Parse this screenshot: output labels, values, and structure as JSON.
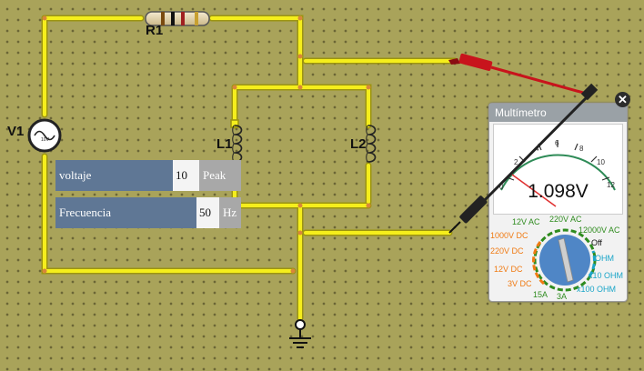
{
  "components": {
    "resistor": "R1",
    "source": "V1",
    "inductor_1": "L1",
    "inductor_2": "L2"
  },
  "source_panel": {
    "voltage_label": "voltaje",
    "voltage_value": "10",
    "voltage_unit": "Peak",
    "frequency_label": "Frecuencia",
    "frequency_value": "50",
    "frequency_unit": "Hz"
  },
  "multimeter": {
    "title": "Multímetro",
    "reading": "1.098V",
    "scale_ticks": [
      "0",
      "2",
      "4",
      "6",
      "8",
      "10",
      "12"
    ],
    "dial_options": {
      "ac_12v": "12V AC",
      "ac_220v": "220V AC",
      "ac_12000v": "12000V AC",
      "off": "Off",
      "dc_1000v": "1000V DC",
      "dc_220v": "220V DC",
      "dc_12v": "12V DC",
      "dc_3v": "3V DC",
      "ohm": "OHM",
      "ohm_x10": "x10 OHM",
      "ohm_x100": "x100 OHM",
      "amp_15a": "15A",
      "amp_3a": "3A"
    },
    "selected_option": "3V DC"
  },
  "colors": {
    "board": "#a9a35a",
    "wire": "#f5ee1c",
    "wire_edge": "#b0a810",
    "probe_red": "#c8141c",
    "probe_black": "#222222",
    "ac_label": "#2e8b1e",
    "dc_label": "#f07a12",
    "ohm_label": "#1aa5c8",
    "amp_label": "#2e8b1e",
    "knob": "#4f86c6"
  }
}
